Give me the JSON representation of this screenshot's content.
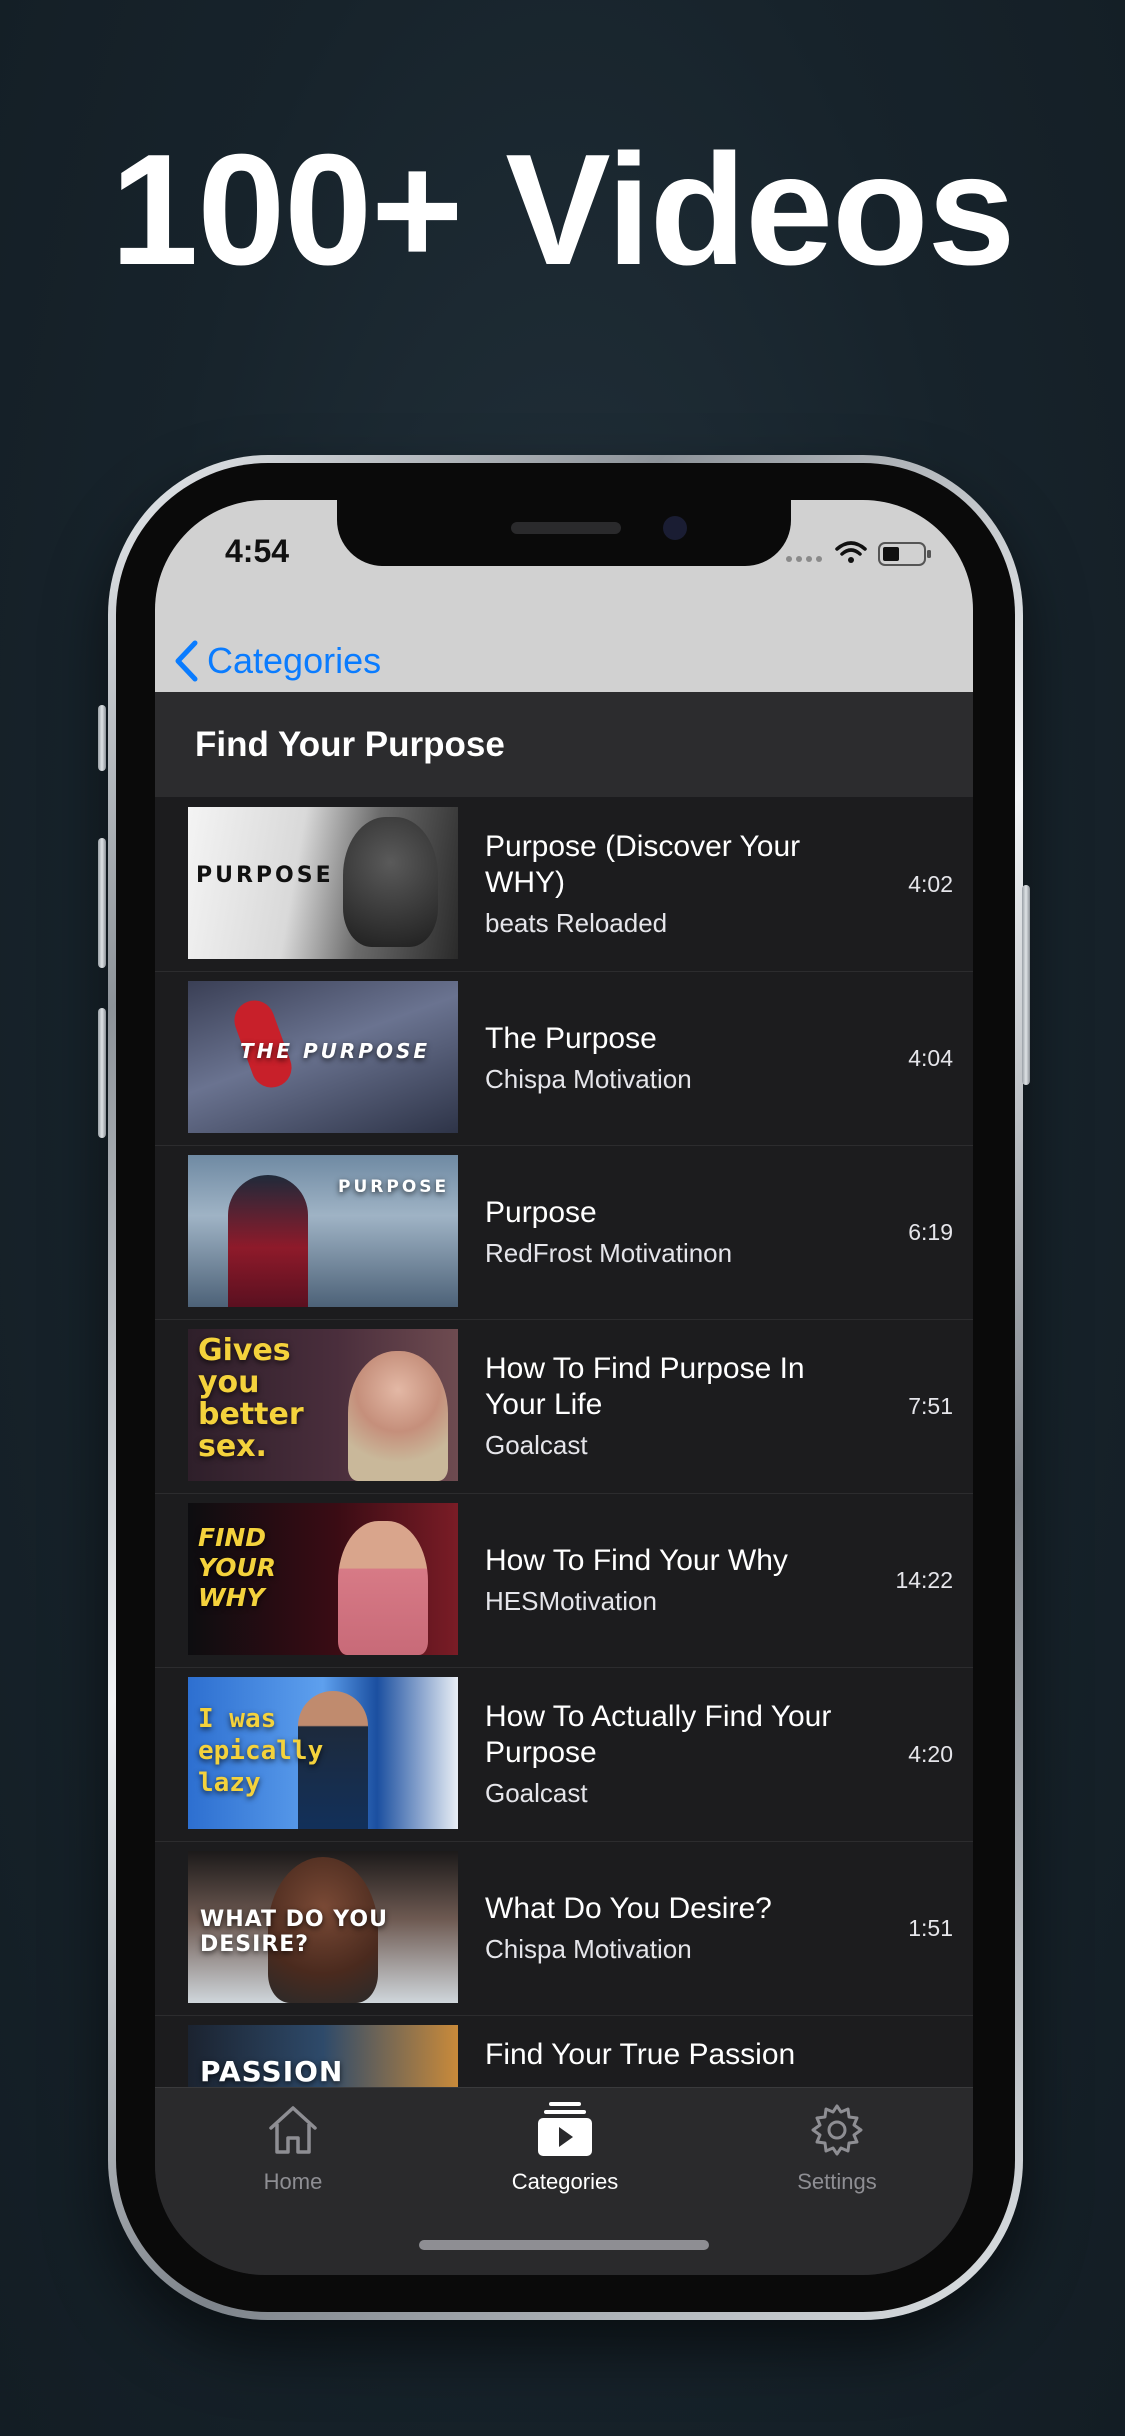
{
  "headline": "100+ Videos",
  "status_bar": {
    "time": "4:54"
  },
  "nav": {
    "back_label": "Categories"
  },
  "section": {
    "title": "Find Your Purpose"
  },
  "videos": [
    {
      "title": "Purpose (Discover Your WHY)",
      "channel": "beats Reloaded",
      "duration": "4:02",
      "thumb_text": "PURPOSE"
    },
    {
      "title": "The Purpose",
      "channel": "Chispa Motivation",
      "duration": "4:04",
      "thumb_text": "THE PURPOSE"
    },
    {
      "title": "Purpose",
      "channel": "RedFrost Motivatinon",
      "duration": "6:19",
      "thumb_text": "PURPOSE"
    },
    {
      "title": "How To Find Purpose In Your Life",
      "channel": "Goalcast",
      "duration": "7:51",
      "thumb_text": "Gives you better sex."
    },
    {
      "title": "How To Find Your Why",
      "channel": "HESMotivation",
      "duration": "14:22",
      "thumb_text": "FIND YOUR WHY"
    },
    {
      "title": "How To Actually Find Your Purpose",
      "channel": "Goalcast",
      "duration": "4:20",
      "thumb_text": "I was epically lazy"
    },
    {
      "title": "What Do You Desire?",
      "channel": "Chispa Motivation",
      "duration": "1:51",
      "thumb_text": "WHAT DO YOU DESIRE?"
    },
    {
      "title": "Find Your True Passion",
      "channel": "",
      "duration": "",
      "thumb_text": "PASSION"
    }
  ],
  "tabbar": {
    "items": [
      {
        "label": "Home",
        "icon": "house-icon",
        "active": false
      },
      {
        "label": "Categories",
        "icon": "video-stack-icon",
        "active": true
      },
      {
        "label": "Settings",
        "icon": "gear-icon",
        "active": false
      }
    ],
    "active_color": "#ffffff",
    "inactive_color": "#8e8e93"
  },
  "colors": {
    "accent": "#0a7cff",
    "background": "#1c1c1e",
    "header": "#2c2c2e"
  }
}
